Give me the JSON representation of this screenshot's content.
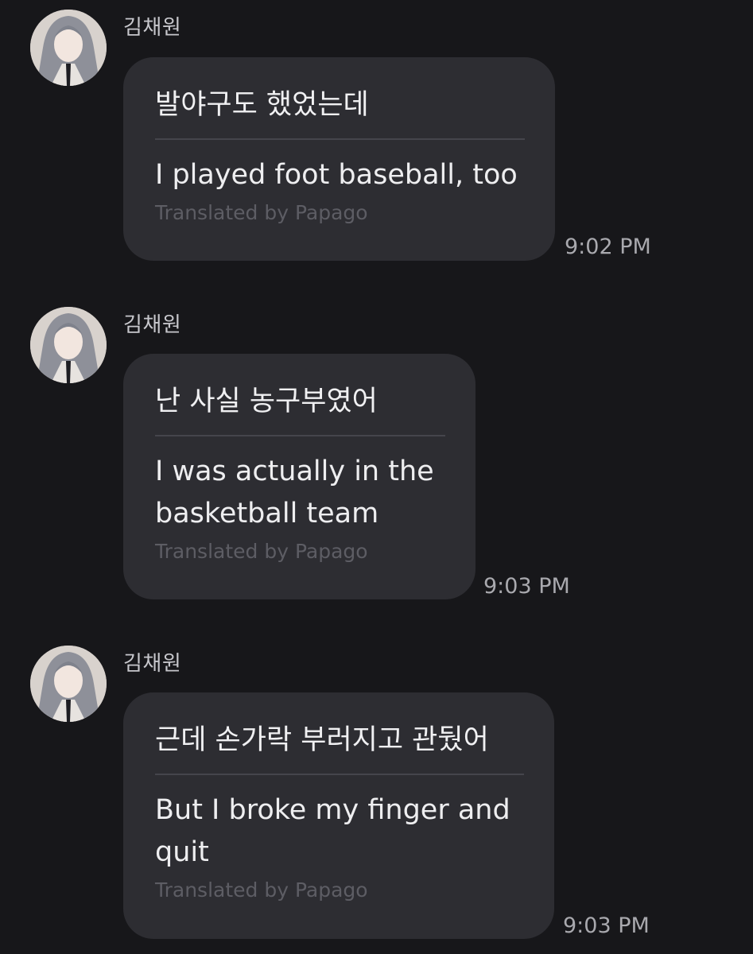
{
  "messages": [
    {
      "sender": "김채원",
      "original": "발야구도 했었는데",
      "translation": "I played foot baseball, too",
      "credit": "Translated by Papago",
      "time": "9:02 PM"
    },
    {
      "sender": "김채원",
      "original": "난 사실 농구부였어",
      "translation": "I was actually in the basketball team",
      "credit": "Translated by Papago",
      "time": "9:03 PM"
    },
    {
      "sender": "김채원",
      "original": "근데 손가락 부러지고 관뒀어",
      "translation": "But I broke my finger and quit",
      "credit": "Translated by Papago",
      "time": "9:03 PM"
    }
  ],
  "colors": {
    "background": "#17171a",
    "bubble": "#2d2d32",
    "credit_text": "#5d5d64"
  }
}
